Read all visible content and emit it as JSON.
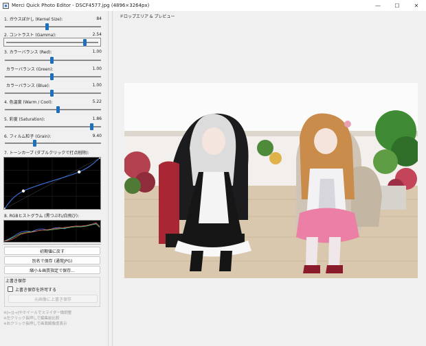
{
  "window": {
    "title": "Merci Quick Photo Editor - DSCF4577.jpg (4896×3264px)",
    "controls": {
      "minimize": "—",
      "maximize": "☐",
      "close": "✕"
    }
  },
  "sliders": [
    {
      "label": "1. ガウスぼかし (Kernel Size):",
      "value": "84",
      "level": 0.44
    },
    {
      "label": "2. コントラスト (Gamma):",
      "value": "2.54",
      "level": 0.86
    },
    {
      "label": "3. カラーバランス (Red):",
      "value": "1.00",
      "level": 0.49
    },
    {
      "label": "カラーバランス (Green):",
      "value": "1.00",
      "level": 0.49
    },
    {
      "label": "カラーバランス (Blue):",
      "value": "1.00",
      "level": 0.49
    },
    {
      "label": "4. 色温度 (Warm / Cool):",
      "value": "5.22",
      "level": 0.55
    },
    {
      "label": "5. 彩度 (Saturation):",
      "value": "1.86",
      "level": 0.9
    },
    {
      "label": "6. フィルム粒子 (Grain):",
      "value": "9.40",
      "level": 0.31
    }
  ],
  "tone_curve": {
    "label": "7. トーンカーブ (ダブルクリックで打点削除):",
    "chart_data": {
      "type": "line",
      "control_points": [
        [
          0.0,
          0.0
        ],
        [
          0.2,
          0.35
        ],
        [
          0.78,
          0.72
        ],
        [
          1.0,
          1.0
        ]
      ],
      "xlim": [
        0,
        1
      ],
      "ylim": [
        0,
        1
      ]
    }
  },
  "histogram": {
    "label": "8. RGBヒストグラム (黒つぶれ/白飛び):"
  },
  "buttons": {
    "reset": "初期値に戻す",
    "save_as": "別名で保存 (通常JPG)",
    "save_resize": "縮小＆画質指定で保存..."
  },
  "overwrite": {
    "group_title": "上書き保存",
    "checkbox_label": "上書き保存を許可する",
    "checked": false,
    "button": "元画像に上書き保存"
  },
  "help": [
    "※[←][→]やホイールでスライダー微調整",
    "※左クリック長押しで編集前比較",
    "※右クリック長押しで画面解像度表示"
  ],
  "preview": {
    "label": "ドロップエリア & プレビュー"
  },
  "colors": {
    "accent": "#1f6fbf",
    "curve_line": "#3d6fd6",
    "hist_red": "#e25b5b",
    "hist_green": "#5fc95f",
    "hist_blue": "#6b7bff"
  }
}
